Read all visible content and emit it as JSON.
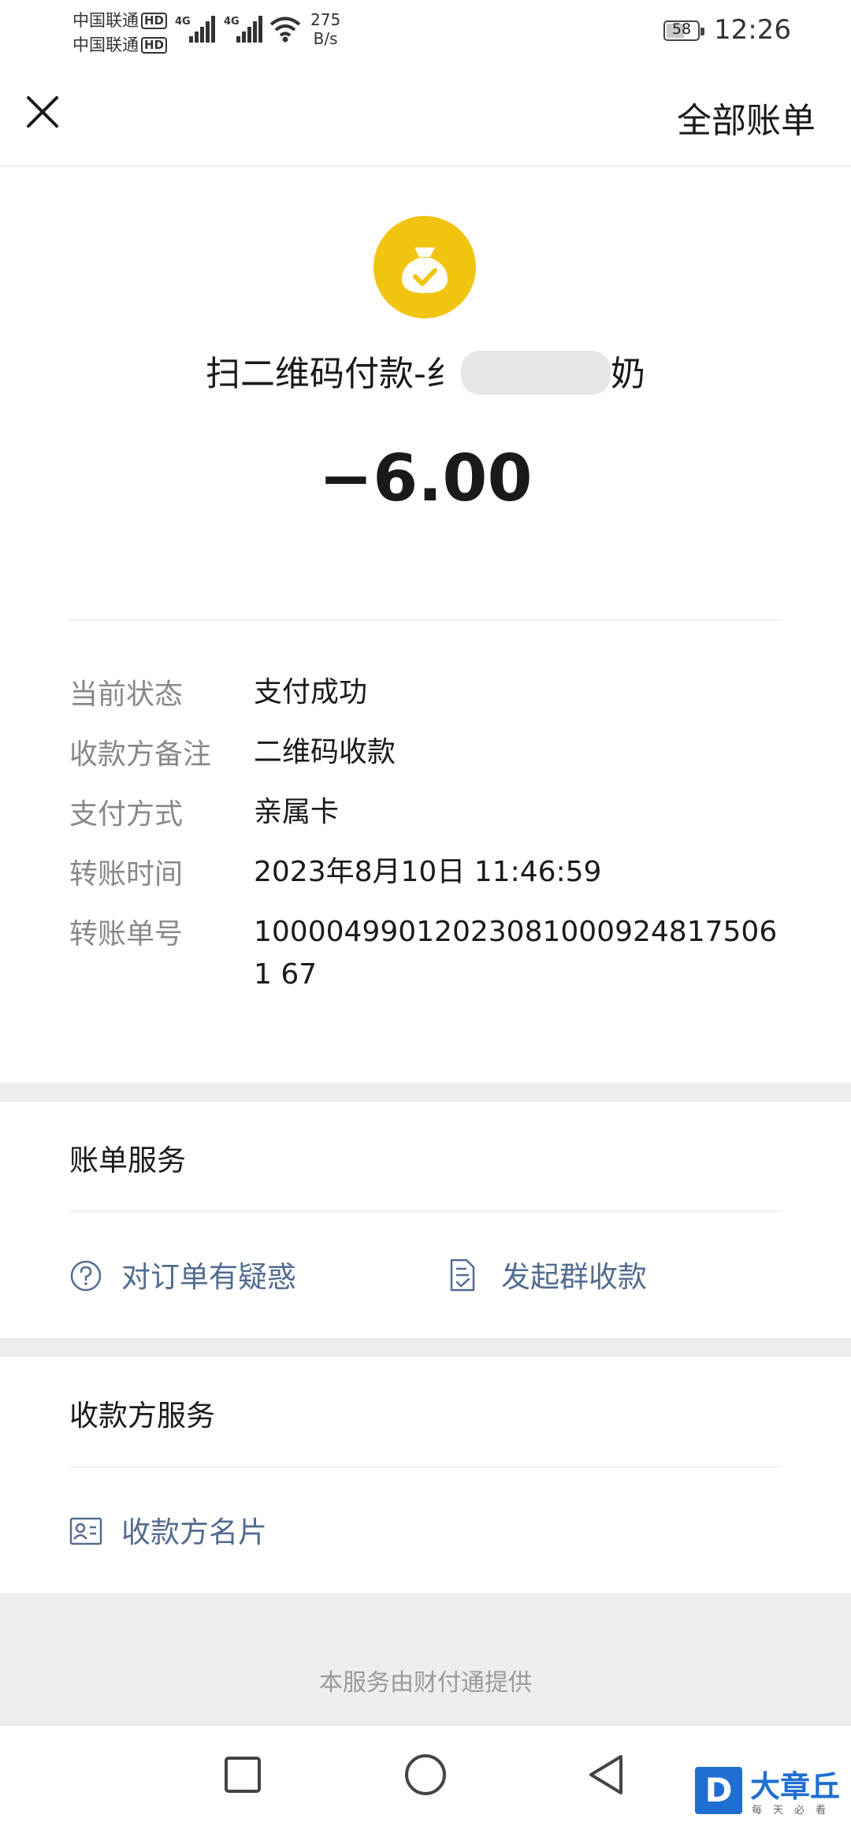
{
  "status_bar": {
    "carrier_1": "中国联通",
    "carrier_2": "中国联通",
    "hd_badge": "HD",
    "network_1": "4G",
    "network_2": "4G",
    "speed_value": "275",
    "speed_unit": "B/s",
    "battery_level": "58",
    "battery_fraction": 0.58,
    "time": "12:26"
  },
  "header": {
    "close_icon": "close-icon",
    "all_bills_label": "全部账单"
  },
  "summary": {
    "icon": "money-bag-check-icon",
    "icon_color": "#f1c40f",
    "merchant_prefix": "扫二维码付款-纟",
    "merchant_suffix": "奶",
    "amount": "−6.00"
  },
  "details": [
    {
      "label": "当前状态",
      "value": "支付成功"
    },
    {
      "label": "收款方备注",
      "value": "二维码收款"
    },
    {
      "label": "支付方式",
      "value": "亲属卡"
    },
    {
      "label": "转账时间",
      "value": "2023年8月10日 11:46:59"
    },
    {
      "label": "转账单号",
      "value": "100004990120230810009248175061 67"
    }
  ],
  "bill_service": {
    "title": "账单服务",
    "item_question": "对订单有疑惑",
    "item_question_icon": "question-circle-icon",
    "item_group_collect": "发起群收款",
    "item_group_collect_icon": "document-check-icon"
  },
  "payee_service": {
    "title": "收款方服务",
    "item_card": "收款方名片",
    "item_card_icon": "contact-card-icon"
  },
  "footer": {
    "text": "本服务由财付通提供"
  },
  "watermark": {
    "logo_letter": "D",
    "title": "大章丘",
    "subtitle": "每天必看"
  },
  "colors": {
    "link": "#526b8f",
    "label_gray": "#888888",
    "section_gap": "#ededed",
    "watermark_blue": "#1f6fd1"
  }
}
